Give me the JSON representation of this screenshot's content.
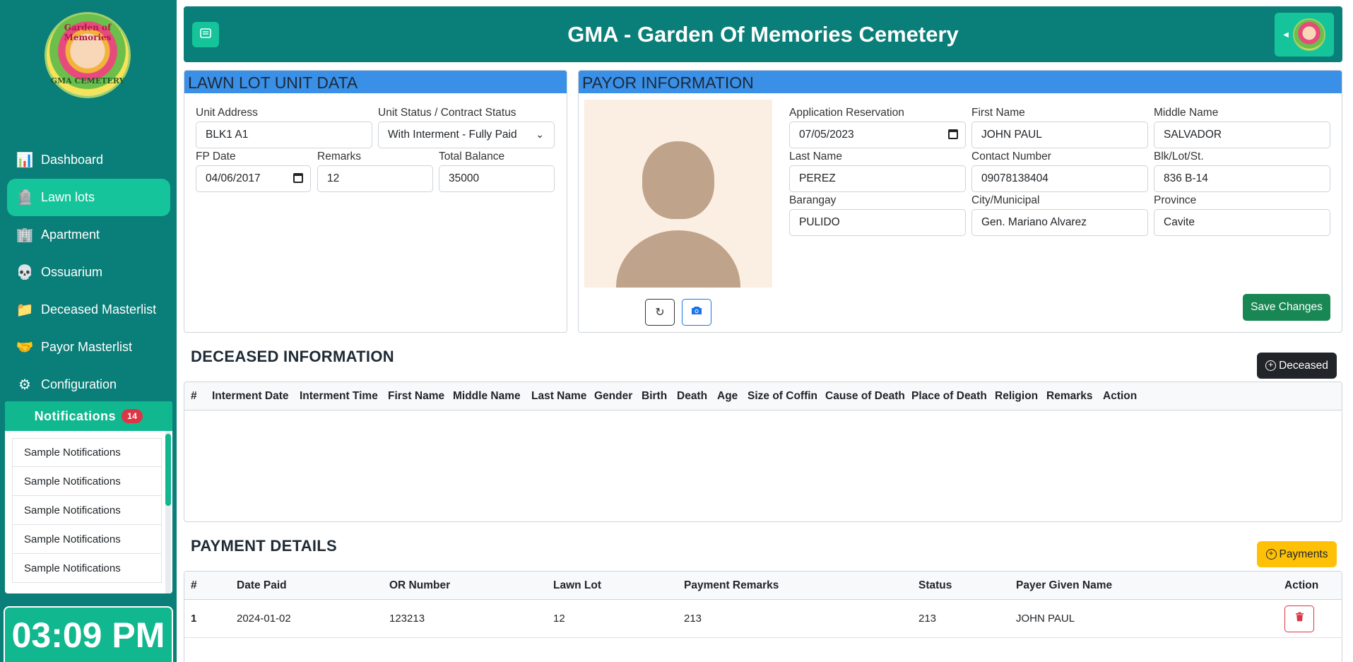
{
  "app": {
    "title": "GMA - Garden Of Memories Cemetery",
    "logo_top_text": "Garden of Memories",
    "logo_bottom_text": "GMA CEMETERY"
  },
  "sidebar": {
    "items": [
      {
        "label": "Dashboard",
        "icon": "dashboard-icon",
        "glyph": "📊"
      },
      {
        "label": "Lawn lots",
        "icon": "lawn-lot-icon",
        "glyph": "🪦"
      },
      {
        "label": "Apartment",
        "icon": "apartment-icon",
        "glyph": "🏢"
      },
      {
        "label": "Ossuarium",
        "icon": "ossuarium-icon",
        "glyph": "💀"
      },
      {
        "label": "Deceased Masterlist",
        "icon": "folder-icon",
        "glyph": "📁"
      },
      {
        "label": "Payor Masterlist",
        "icon": "payor-icon",
        "glyph": "🤝"
      },
      {
        "label": "Configuration",
        "icon": "configuration-icon",
        "glyph": "⚙"
      }
    ],
    "active_index": 1
  },
  "notifications": {
    "title": "Notifications",
    "count": "14",
    "items": [
      "Sample Notifications",
      "Sample Notifications",
      "Sample Notifications",
      "Sample Notifications",
      "Sample Notifications"
    ]
  },
  "clock": {
    "time": "03:09 PM"
  },
  "lawn_lot": {
    "heading": "LAWN LOT UNIT DATA",
    "unit_address_label": "Unit Address",
    "unit_address": "BLK1 A1",
    "status_label": "Unit Status / Contract Status",
    "status": "With Interment - Fully Paid",
    "fp_date_label": "FP Date",
    "fp_date": "04/06/2017",
    "remarks_label": "Remarks",
    "remarks": "12",
    "balance_label": "Total Balance",
    "balance": "35000"
  },
  "payor": {
    "heading": "PAYOR INFORMATION",
    "application_label": "Application Reservation",
    "application": "07/05/2023",
    "first_name_label": "First Name",
    "first_name": "JOHN PAUL",
    "middle_name_label": "Middle Name",
    "middle_name": "SALVADOR",
    "last_name_label": "Last Name",
    "last_name": "PEREZ",
    "contact_label": "Contact Number",
    "contact": "09078138404",
    "blk_label": "Blk/Lot/St.",
    "blk": "836 B-14",
    "barangay_label": "Barangay",
    "barangay": "PULIDO",
    "city_label": "City/Municipal",
    "city": "Gen. Mariano Alvarez",
    "province_label": "Province",
    "province": "Cavite",
    "save_label": "Save Changes"
  },
  "deceased": {
    "heading": "DECEASED INFORMATION",
    "add_label": "Deceased",
    "columns": [
      "#",
      "Interment Date",
      "Interment Time",
      "First Name",
      "Middle Name",
      "Last Name",
      "Gender",
      "Birth",
      "Death",
      "Age",
      "Size of Coffin",
      "Cause of Death",
      "Place of Death",
      "Religion",
      "Remarks",
      "Action"
    ]
  },
  "payments": {
    "heading": "PAYMENT DETAILS",
    "add_label": "Payments",
    "columns": [
      "#",
      "Date Paid",
      "OR Number",
      "Lawn Lot",
      "Payment Remarks",
      "Status",
      "Payer Given Name",
      "Action"
    ],
    "rows": [
      {
        "no": "1",
        "date_paid": "2024-01-02",
        "or_number": "123213",
        "lawn_lot": "12",
        "remarks": "213",
        "status": "213",
        "payer": "JOHN PAUL"
      }
    ]
  }
}
